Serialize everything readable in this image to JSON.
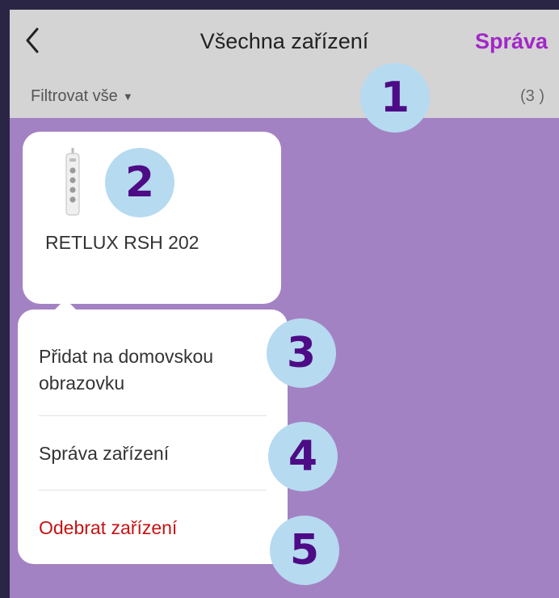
{
  "navbar": {
    "back_icon": "chevron-left-icon",
    "title": "Všechna zařízení",
    "manage_label": "Správa",
    "accent_color": "#a227c8"
  },
  "filterbar": {
    "filter_label": "Filtrovat vše",
    "caret": "▼",
    "count": "(3 )"
  },
  "device": {
    "name": "RETLUX RSH 202",
    "icon": "power-strip-icon"
  },
  "context_menu": {
    "items": [
      {
        "label": "Přidat na domovskou obrazovku"
      },
      {
        "label": "Správa zařízení"
      },
      {
        "label": "Odebrat zařízení",
        "color": "#c41313"
      }
    ]
  },
  "steps": [
    "1",
    "2",
    "3",
    "4",
    "5"
  ]
}
